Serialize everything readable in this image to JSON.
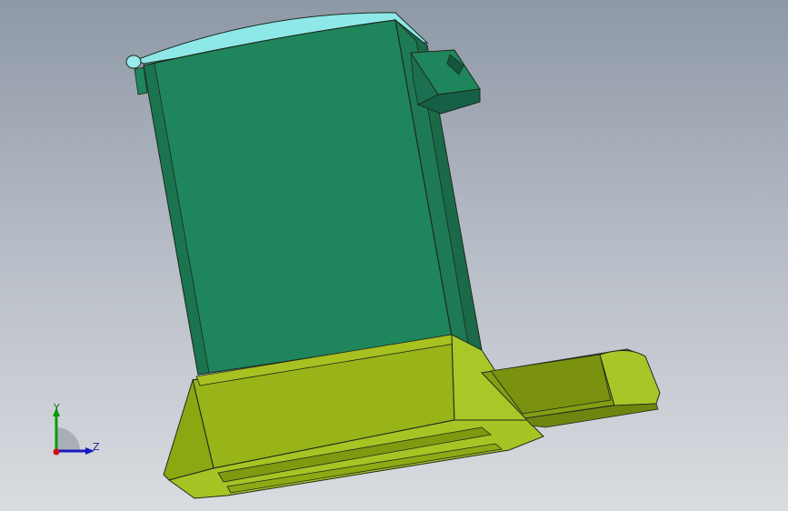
{
  "viewport": {
    "background_top": "#8e98a6",
    "background_bottom": "#d9dce0"
  },
  "model": {
    "body_color": "#1f855c",
    "body_side_color": "#1a6a4a",
    "lid_color": "#8ee8e8",
    "base_color": "#98b418",
    "base_dark_color": "#7e9a10",
    "edge_color": "#1c2a1c"
  },
  "triad": {
    "y_label": "Y",
    "z_label": "Z",
    "y_color": "#0a9a0a",
    "z_color": "#1a1ac0",
    "origin_color": "#d01010"
  }
}
